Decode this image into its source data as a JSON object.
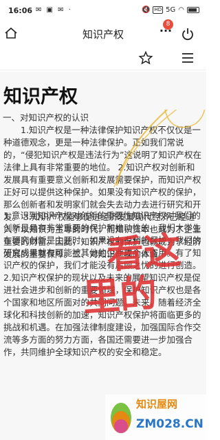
{
  "status_bar": {
    "time": "16:06",
    "left_icons": "✉ ▣ ✉ ·",
    "hd_label": "HD",
    "signal": "5G"
  },
  "nav": {
    "title": "知识产权",
    "badge_count": "8",
    "more_label": "···"
  },
  "article": {
    "title": "知识产权",
    "section_heading": "一、对知识产权的认识",
    "paragraph_1": "1.知识产权是一种法律保护知识产权不仅仅是一种道德观念，更是一种法律保护。正如我们常说的，“侵犯知识产权是违法行为”这说明了知识产权在法律上具有非常重要的地位。 2.知识产权对创新和发展具有重要意义创新和发展需要保护，而知识产权正好可以提供这种保护。如果没有知识产权的保护，那么创新者和发明家们就会失去动力去进行研究和开发。 3.知识产权能够促进经济发展现代经济已经进入了以知识为主导的时代，而知识资本也成为了企业重要的财富。因此，知识产权的保护也就成为了经济发展的重要保障。二、对知识产权的体会",
    "paragraph_2": "1.意识到知识产权对创新的重要性知识产权对我们的创新是具有非常重要的保护和推动性的，我们大学生在研究创新是主题时，如果没有专利的保护，我们的研究成果就有可能被其他的企业或个人盗用。有了知识产权的保护，我们才能没有后顾之忧的进行创造。 2.知识产权保护的现状以及未来的展望知识产权是促进社会进步和创新的重要领域，保护知识产权也是各个国家和地区所面对的共同问题。未来，随着经济全球化和科技创新的加速，知识产权保护将面临更多的挑战和机遇。在加强法律制度建设，加强国际合作交流等多方面的努力方面，各国还需要进一步加强合作，共同维护全球知识产权的安全和稳定。"
  },
  "annotation": {
    "line1": "看这",
    "line2": "里的"
  },
  "watermark": {
    "line1": "知识屋网",
    "line2": "ZM028.CN"
  },
  "colors": {
    "annotation": "#d33",
    "badge": "#e74c3c",
    "watermark_orange": "#e48a11",
    "watermark_blue": "#2a76c6"
  }
}
